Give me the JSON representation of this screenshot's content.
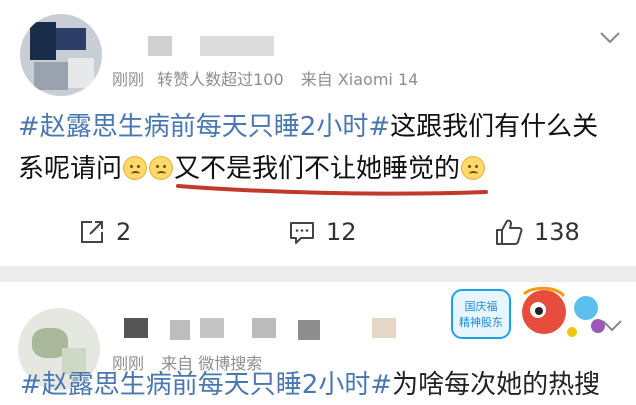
{
  "post1": {
    "meta": {
      "time": "刚刚",
      "reposts": "转赞人数超过100",
      "source": "来自 Xiaomi 14"
    },
    "text": {
      "topic": "#赵露思生病前每天只睡2小时#",
      "line1_rest": "这跟我们有什么关",
      "line2_start": "系呢请问",
      "highlighted": "又不是我们不让她睡觉的"
    },
    "actions": {
      "repost_count": "2",
      "comment_count": "12",
      "like_count": "138"
    }
  },
  "post2": {
    "meta": {
      "time": "刚刚",
      "source": "来自 微博搜索"
    },
    "badge": {
      "line1": "国庆福",
      "line2": "精神股东"
    },
    "text": {
      "topic": "#赵露思生病前每天只睡2小时#",
      "rest": "为啥每次她的热搜"
    }
  },
  "colors": {
    "topic": "#4b77b0",
    "meta": "#8e8e8e",
    "underline": "#c0392b"
  },
  "icons": [
    "chevron-down-icon",
    "repost-icon",
    "comment-icon",
    "like-icon"
  ]
}
